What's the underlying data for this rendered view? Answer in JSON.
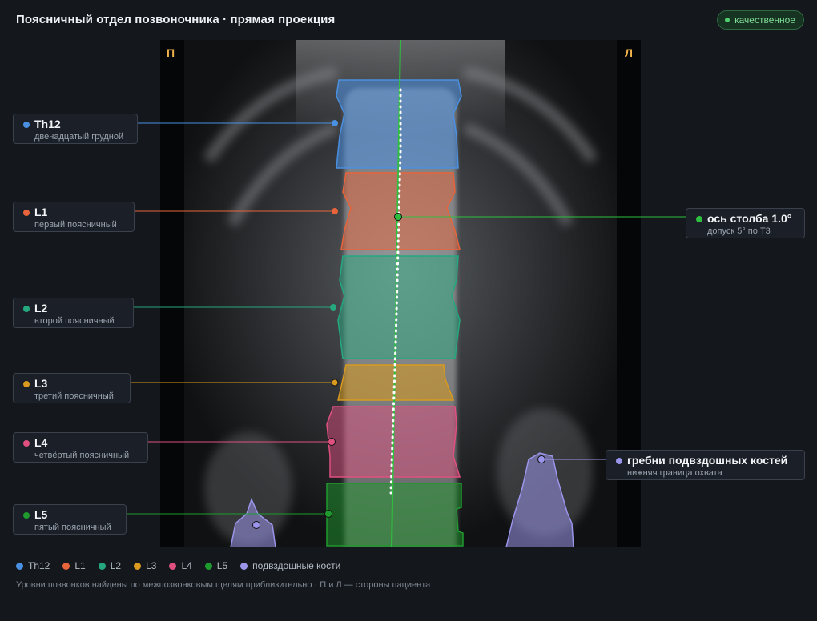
{
  "header": {
    "title": "Поясничный отдел позвоночника · прямая проекция",
    "badge": "качественное"
  },
  "viewer": {
    "side_left": "П",
    "side_right": "Л"
  },
  "colors": {
    "th12": "#4a90e2",
    "l1": "#e8643a",
    "l2": "#25a87d",
    "l3": "#d99a1e",
    "l4": "#e0507f",
    "l5": "#1f9a2e",
    "iliac": "#9a95ea",
    "axis": "#2fbf3f"
  },
  "vertebrae": [
    {
      "key": "th12",
      "name": "Th12",
      "sub": "двенадцатый грудной",
      "color": "#4a90e2"
    },
    {
      "key": "l1",
      "name": "L1",
      "sub": "первый поясничный",
      "color": "#e8643a"
    },
    {
      "key": "l2",
      "name": "L2",
      "sub": "второй поясничный",
      "color": "#25a87d"
    },
    {
      "key": "l3",
      "name": "L3",
      "sub": "третий поясничный",
      "color": "#d99a1e"
    },
    {
      "key": "l4",
      "name": "L4",
      "sub": "четвёртый поясничный",
      "color": "#e0507f"
    },
    {
      "key": "l5",
      "name": "L5",
      "sub": "пятый поясничный",
      "color": "#1f9a2e"
    }
  ],
  "axis_card": {
    "name": "ось столба 1.0°",
    "sub": "допуск 5° по Т3",
    "color": "#2fbf3f"
  },
  "iliac_card": {
    "name": "гребни подвздошных костей",
    "sub": "нижняя граница охвата",
    "color": "#9a95ea"
  },
  "legend": [
    {
      "label": "Th12",
      "color": "#4a90e2"
    },
    {
      "label": "L1",
      "color": "#e8643a"
    },
    {
      "label": "L2",
      "color": "#25a87d"
    },
    {
      "label": "L3",
      "color": "#d99a1e"
    },
    {
      "label": "L4",
      "color": "#e0507f"
    },
    {
      "label": "L5",
      "color": "#1f9a2e"
    },
    {
      "label": "подвздошные кости",
      "color": "#9a95ea"
    }
  ],
  "footnote": "Уровни позвонков найдены по межпозвонковым щелям приблизительно · П и Л — стороны пациента"
}
